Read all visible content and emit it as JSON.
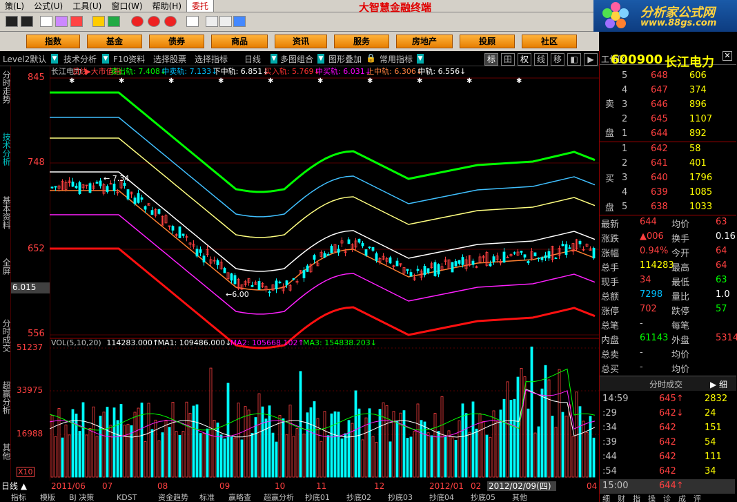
{
  "menu": {
    "items": [
      "策(L)",
      "公式(U)",
      "工具(U)",
      "窗口(W)",
      "帮助(H)",
      "委托"
    ],
    "app_title": "大智慧金融终端"
  },
  "logo": {
    "line1": "分析家公式网",
    "line2": "www.88gs.com"
  },
  "nav": {
    "buttons": [
      "指数",
      "基金",
      "债券",
      "商品",
      "资讯",
      "服务",
      "房地产",
      "投顾",
      "社区"
    ]
  },
  "toolbar2": {
    "items": [
      "Level2默认",
      "技术分析",
      "F10资料",
      "选择股票",
      "选择指标",
      "日线",
      "多图组合",
      "图形叠加",
      "常用指标"
    ],
    "right_buttons": [
      "标",
      "田",
      "权",
      "线",
      "移",
      "◧",
      "▶"
    ]
  },
  "lefttabs": [
    "分时走势",
    "技术分析",
    "基本资料",
    "全屏",
    "分时成交",
    "超赢分析",
    "其他"
  ],
  "price_axis": {
    "labels": [
      "845",
      "748",
      "652",
      "556"
    ],
    "current": "6.015"
  },
  "vol_axis": {
    "labels": [
      "51237",
      "33975",
      "16988"
    ],
    "x10": "X10"
  },
  "chart_header": {
    "stock": "长江电力",
    "period": "日线",
    "index": "大市值指",
    "items": [
      {
        "text": "卖出轨: 7.408↓",
        "color": "#00ff00"
      },
      {
        "text": "中卖轨: 7.133↓",
        "color": "#00c0ff"
      },
      {
        "text": "下中轨: 6.851↓",
        "color": "#ffffff"
      },
      {
        "text": "买入轨: 5.769↓",
        "color": "#ff3030"
      },
      {
        "text": "中买轨: 6.031↓",
        "color": "#ff00ff"
      },
      {
        "text": "上中轨: 6.306↓",
        "color": "#ff8040"
      },
      {
        "text": "中轨: 6.556↓",
        "color": "#ffffff"
      }
    ],
    "annotation_high": "7.34",
    "annotation_low": "6.00"
  },
  "vol_header": {
    "items": [
      {
        "text": "VOL(5,10,20)",
        "color": "#c0c0c0"
      },
      {
        "text": "114283.000↑",
        "color": "#ffffff"
      },
      {
        "text": "MA1: 109486.000↓",
        "color": "#ffffff"
      },
      {
        "text": "MA2: 105668.102↑",
        "color": "#ff00ff"
      },
      {
        "text": "MA3: 154838.203↓",
        "color": "#00ff00"
      }
    ]
  },
  "date_axis": {
    "labels": [
      "2011/06",
      "07",
      "08",
      "09",
      "10",
      "11",
      "12",
      "2012/01",
      "02",
      "2012/02/09(四)",
      "04"
    ]
  },
  "bottom_tabs": {
    "period": "日线",
    "items": [
      "指标",
      "模版",
      "BJ 决策",
      "KDST",
      "资金趋势",
      "标准",
      "赢略查",
      "超赢分析",
      "抄底01",
      "抄底02",
      "抄底03",
      "抄底04",
      "抄底05",
      "其他"
    ]
  },
  "right_panel": {
    "work_area": "工作区",
    "code": "600900",
    "name": "长江电力",
    "sell_label": [
      "卖",
      "盘"
    ],
    "buy_label": [
      "买",
      "盘"
    ],
    "sell": [
      {
        "n": "5",
        "p": "648",
        "v": "606"
      },
      {
        "n": "4",
        "p": "647",
        "v": "374"
      },
      {
        "n": "3",
        "p": "646",
        "v": "896"
      },
      {
        "n": "2",
        "p": "645",
        "v": "1107"
      },
      {
        "n": "1",
        "p": "644",
        "v": "892"
      }
    ],
    "buy": [
      {
        "n": "1",
        "p": "642",
        "v": "58"
      },
      {
        "n": "2",
        "p": "641",
        "v": "401"
      },
      {
        "n": "3",
        "p": "640",
        "v": "1796"
      },
      {
        "n": "4",
        "p": "639",
        "v": "1085"
      },
      {
        "n": "5",
        "p": "638",
        "v": "1033"
      }
    ],
    "quote": [
      {
        "l": "最新",
        "v": "644",
        "vc": "#ff4040",
        "l2": "均价",
        "v2": "63",
        "v2c": "#ff4040"
      },
      {
        "l": "涨跌",
        "v": "▲006",
        "vc": "#ff4040",
        "l2": "换手",
        "v2": "0.16",
        "v2c": "#fff"
      },
      {
        "l": "涨幅",
        "v": "0.94%",
        "vc": "#ff4040",
        "l2": "今开",
        "v2": "64",
        "v2c": "#ff4040"
      },
      {
        "l": "总手",
        "v": "114283",
        "vc": "#ffff00",
        "l2": "最高",
        "v2": "64",
        "v2c": "#ff4040"
      },
      {
        "l": "现手",
        "v": "34",
        "vc": "#ff4040",
        "l2": "最低",
        "v2": "63",
        "v2c": "#00ff00"
      },
      {
        "l": "总额",
        "v": "7298",
        "vc": "#00c0ff",
        "l2": "量比",
        "v2": "1.0",
        "v2c": "#fff"
      },
      {
        "l": "涨停",
        "v": "702",
        "vc": "#ff4040",
        "l2": "跌停",
        "v2": "57",
        "v2c": "#00ff00"
      },
      {
        "l": "总笔",
        "v": "-",
        "vc": "#c0c0c0",
        "l2": "每笔",
        "v2": "",
        "v2c": "#fff"
      },
      {
        "l": "内盘",
        "v": "61143",
        "vc": "#00ff00",
        "l2": "外盘",
        "v2": "5314",
        "v2c": "#ff4040"
      },
      {
        "l": "总卖",
        "v": "-",
        "vc": "#c0c0c0",
        "l2": "均价",
        "v2": "",
        "v2c": "#fff"
      },
      {
        "l": "总买",
        "v": "-",
        "vc": "#c0c0c0",
        "l2": "均价",
        "v2": "",
        "v2c": "#fff"
      }
    ],
    "ticks_title": "分时成交",
    "ticks_btn": "细",
    "ticks": [
      {
        "t": "14:59",
        "p": "645↑",
        "pc": "#ff4040",
        "v": "2832"
      },
      {
        "t": ":29",
        "p": "642↓",
        "pc": "#ff4040",
        "v": "24"
      },
      {
        "t": ":34",
        "p": "642",
        "pc": "#ff4040",
        "v": "151"
      },
      {
        "t": ":39",
        "p": "642",
        "pc": "#ff4040",
        "v": "54"
      },
      {
        "t": ":44",
        "p": "642",
        "pc": "#ff4040",
        "v": "111"
      },
      {
        "t": ":54",
        "p": "642",
        "pc": "#ff4040",
        "v": "34"
      },
      {
        "t": "15:00",
        "p": "644↑",
        "pc": "#ff4040",
        "v": ""
      }
    ],
    "bottom_tabs": [
      "细",
      "财",
      "指",
      "操",
      "诊",
      "成",
      "评"
    ]
  },
  "colors": {
    "up": "#ff4040",
    "down": "#00ffff",
    "bg": "#000000",
    "nav": "#ff9a1a"
  }
}
